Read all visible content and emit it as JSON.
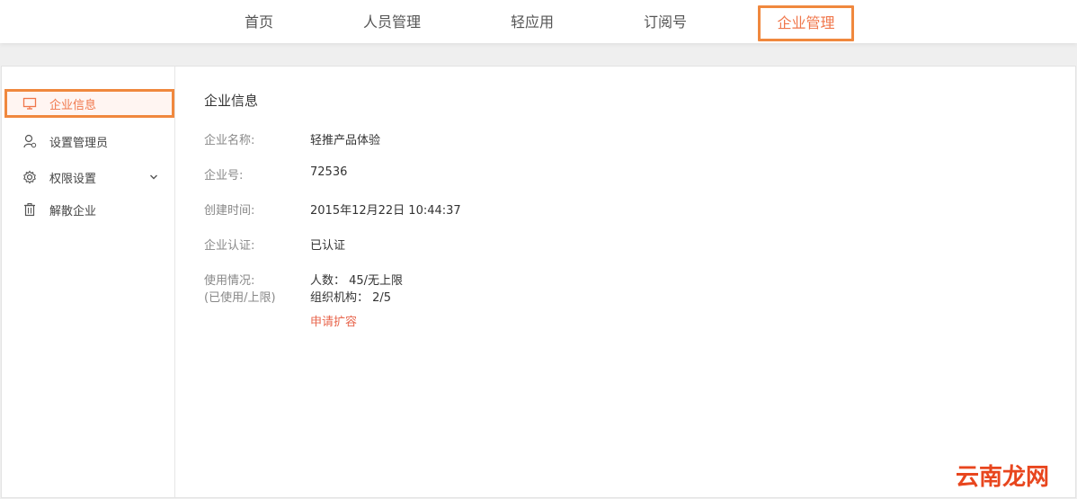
{
  "topnav": {
    "items": [
      {
        "label": "首页"
      },
      {
        "label": "人员管理"
      },
      {
        "label": "轻应用"
      },
      {
        "label": "订阅号"
      },
      {
        "label": "企业管理"
      }
    ],
    "active_index": 4
  },
  "sidebar": {
    "items": [
      {
        "label": "企业信息",
        "icon": "monitor-icon"
      },
      {
        "label": "设置管理员",
        "icon": "admin-user-icon"
      },
      {
        "label": "权限设置",
        "icon": "gear-icon"
      },
      {
        "label": "解散企业",
        "icon": "trash-icon"
      }
    ],
    "active_index": 0
  },
  "content": {
    "title": "企业信息",
    "rows": [
      {
        "label": "企业名称:",
        "value": "轻推产品体验"
      },
      {
        "label": "企业号:",
        "value": "72536"
      },
      {
        "label": "创建时间:",
        "value": "2015年12月22日 10:44:37"
      },
      {
        "label": "企业认证:",
        "value": "已认证"
      }
    ],
    "usage": {
      "label_line1": "使用情况:",
      "label_line2": "(已使用/上限)",
      "people": "人数： 45/无上限",
      "orgs": "组织机构： 2/5",
      "expand_link": "申请扩容"
    }
  },
  "watermark": "云南龙网",
  "colors": {
    "accent": "#f0883e",
    "active_text": "#f0764a",
    "link": "#e8664d"
  }
}
